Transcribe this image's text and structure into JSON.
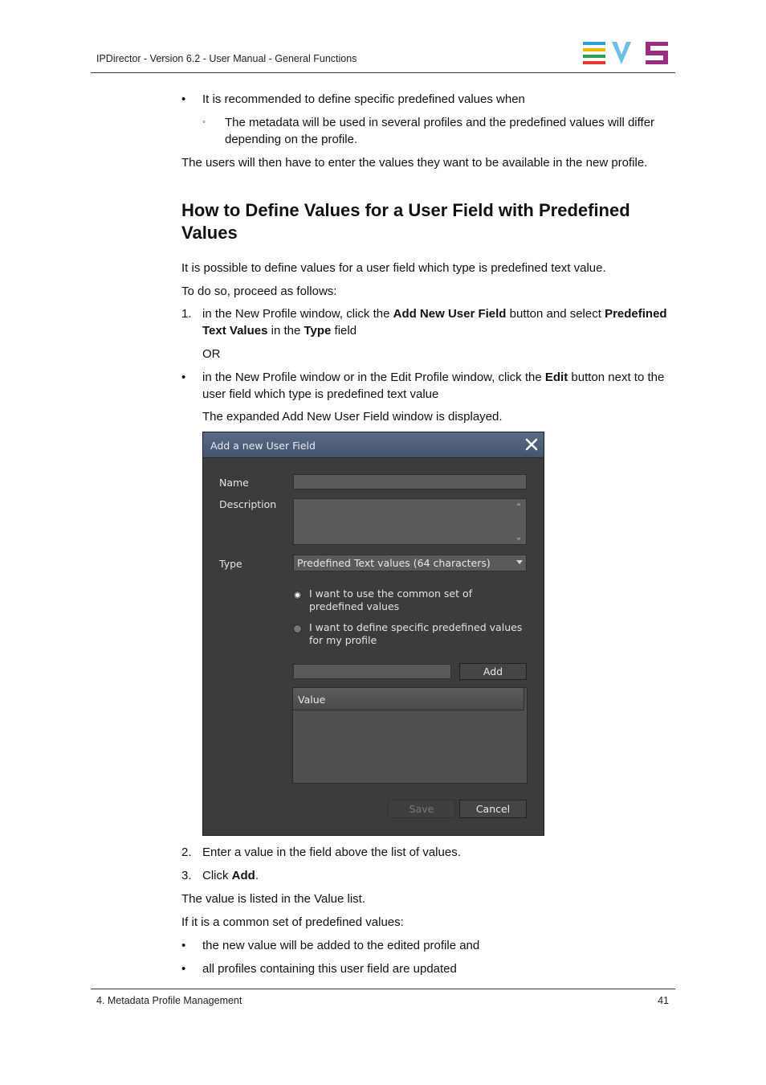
{
  "header": {
    "text": "IPDirector - Version 6.2 - User Manual - General Functions",
    "logo_colors": {
      "bars": [
        "#2a9fd8",
        "#f4b400",
        "#2ea44f",
        "#e63b2e"
      ],
      "v": "#6cc0e8",
      "s": "#9b2d82"
    }
  },
  "content": {
    "bullet1": "It is recommended to define specific predefined values when",
    "subbullet1": "The metadata will be used in several profiles and the predefined values will differ depending on the profile.",
    "para1": "The users will then have to enter the values they want to be available in the new profile.",
    "heading": "How to Define Values for a User Field with Predefined Values",
    "para2": "It is possible to define values for a user field which type is predefined text value.",
    "para3": "To do so, proceed as follows:",
    "step1_num": "1.",
    "step1_a": "in the New Profile window, click the ",
    "step1_b": "Add New User Field",
    "step1_c": " button and select ",
    "step1_d": "Predefined Text Values",
    "step1_e": " in the ",
    "step1_f": "Type",
    "step1_g": " field",
    "or": "OR",
    "bullet2_a": "in the New Profile window or in the Edit Profile window, click the ",
    "bullet2_b": "Edit",
    "bullet2_c": " button next to the user field which type is predefined text value",
    "para4": "The expanded Add New User Field window is displayed.",
    "step2_num": "2.",
    "step2": "Enter a value in the field above the list of values.",
    "step3_num": "3.",
    "step3_a": "Click ",
    "step3_b": "Add",
    "step3_c": ".",
    "para5": "The value is listed in the Value list.",
    "para6": "If it is a common set of predefined values:",
    "bullet3": "the new value will be added to the edited profile and",
    "bullet4": "all profiles containing this user field are updated"
  },
  "dialog": {
    "title": "Add a new User Field",
    "name_label": "Name",
    "description_label": "Description",
    "type_label": "Type",
    "type_value": "Predefined Text values (64 characters)",
    "radio_common": "I want to use the common set of predefined values",
    "radio_specific": "I want to define specific predefined values for my profile",
    "add_button": "Add",
    "list_header": "Value",
    "save_button": "Save",
    "cancel_button": "Cancel"
  },
  "footer": {
    "section": "4. Metadata Profile Management",
    "page": "41"
  }
}
